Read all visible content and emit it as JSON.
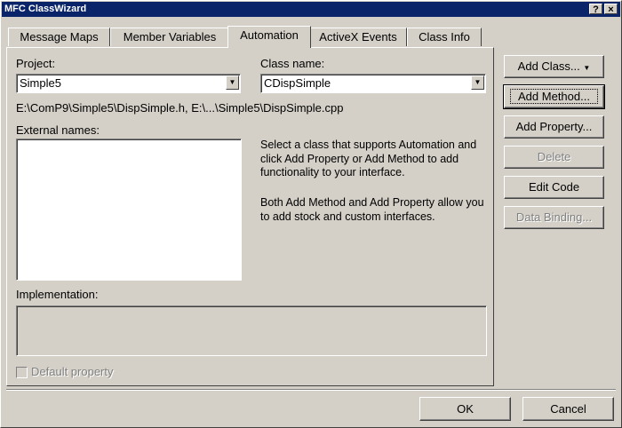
{
  "window": {
    "title": "MFC ClassWizard",
    "help_label": "?",
    "close_label": "×"
  },
  "tabs": [
    {
      "label": "Message Maps"
    },
    {
      "label": "Member Variables"
    },
    {
      "label": "Automation"
    },
    {
      "label": "ActiveX Events"
    },
    {
      "label": "Class Info"
    }
  ],
  "project": {
    "label": "Project:",
    "value": "Simple5"
  },
  "class_name": {
    "label": "Class name:",
    "value": "CDispSimple"
  },
  "file_path": "E:\\ComP9\\Simple5\\DispSimple.h, E:\\...\\Simple5\\DispSimple.cpp",
  "external_names": {
    "label": "External names:",
    "items": []
  },
  "description": {
    "para1": "Select a class that supports Automation and click Add Property or Add Method to add functionality to your interface.",
    "para2": "Both Add Method and Add Property allow you to add stock and custom interfaces."
  },
  "implementation": {
    "label": "Implementation:",
    "value": ""
  },
  "default_property": {
    "label": "Default property",
    "checked": false,
    "enabled": false
  },
  "buttons": {
    "add_class": "Add Class...",
    "add_method": "Add Method...",
    "add_property": "Add Property...",
    "delete": "Delete",
    "edit_code": "Edit Code",
    "data_binding": "Data Binding...",
    "ok": "OK",
    "cancel": "Cancel"
  }
}
